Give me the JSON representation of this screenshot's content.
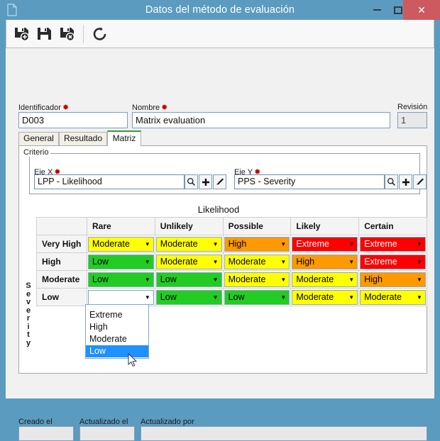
{
  "window": {
    "title": "Datos del método de evaluación",
    "doc_icon": "document-icon",
    "minimize_label": "−",
    "maximize_label": "□",
    "close_label": "✕",
    "close_color": "#cd5a5e",
    "titlebar_color": "#5b9bc0"
  },
  "toolbar": {
    "save_new": "save-new-icon",
    "save": "save-icon",
    "save_delete": "save-delete-icon",
    "refresh": "refresh-icon"
  },
  "form": {
    "identificador_label": "Identificador",
    "identificador_value": "D003",
    "nombre_label": "Nombre",
    "nombre_value": "Matrix evaluation",
    "revision_label": "Revisión",
    "revision_value": "1",
    "required_marker": "✹"
  },
  "tabs": [
    {
      "label": "General",
      "active": false
    },
    {
      "label": "Resultado",
      "active": false
    },
    {
      "label": "Matriz",
      "active": true
    }
  ],
  "criterio": {
    "legend": "Criterio",
    "eje_x_label": "Eje X",
    "eje_x_value": "LPP - Likelihood",
    "eje_y_label": "Eje Y",
    "eje_y_value": "PPS - Severity",
    "buttons": [
      "search-icon",
      "add-icon",
      "clear-brush-icon"
    ]
  },
  "matrix": {
    "x_axis_title": "Likelihood",
    "y_axis_title": "Severity",
    "columns": [
      "Rare",
      "Unlikely",
      "Possible",
      "Likely",
      "Certain"
    ],
    "rows": [
      "Very High",
      "High",
      "Moderate",
      "Low"
    ],
    "cells": [
      [
        {
          "value": "Moderate",
          "level": "moderate"
        },
        {
          "value": "Moderate",
          "level": "moderate"
        },
        {
          "value": "High",
          "level": "high"
        },
        {
          "value": "Extreme",
          "level": "extreme"
        },
        {
          "value": "Extreme",
          "level": "extreme"
        }
      ],
      [
        {
          "value": "Low",
          "level": "low"
        },
        {
          "value": "Moderate",
          "level": "moderate"
        },
        {
          "value": "Moderate",
          "level": "moderate"
        },
        {
          "value": "High",
          "level": "high"
        },
        {
          "value": "Extreme",
          "level": "extreme"
        }
      ],
      [
        {
          "value": "Low",
          "level": "low"
        },
        {
          "value": "Low",
          "level": "low"
        },
        {
          "value": "Moderate",
          "level": "moderate"
        },
        {
          "value": "Moderate",
          "level": "moderate"
        },
        {
          "value": "High",
          "level": "high"
        }
      ],
      [
        {
          "value": "",
          "level": "empty"
        },
        {
          "value": "Low",
          "level": "low"
        },
        {
          "value": "Low",
          "level": "low"
        },
        {
          "value": "Moderate",
          "level": "moderate"
        },
        {
          "value": "Moderate",
          "level": "moderate"
        }
      ]
    ],
    "level_colors": {
      "low": "#22cc22",
      "moderate": "#ffff00",
      "high": "#ff9900",
      "extreme": "#ff0000",
      "empty": "#ffffff"
    },
    "arrow_glyph": "▼"
  },
  "dropdown": {
    "open": true,
    "options": [
      "Extreme",
      "High",
      "Moderate",
      "Low"
    ],
    "selected": "Low",
    "highlight_color": "#1e90ff"
  },
  "footer": {
    "creado_label": "Creado el",
    "creado_value": "",
    "actualizado_el_label": "Actualizado el",
    "actualizado_el_value": "",
    "actualizado_por_label": "Actualizado por",
    "actualizado_por_value": ""
  }
}
